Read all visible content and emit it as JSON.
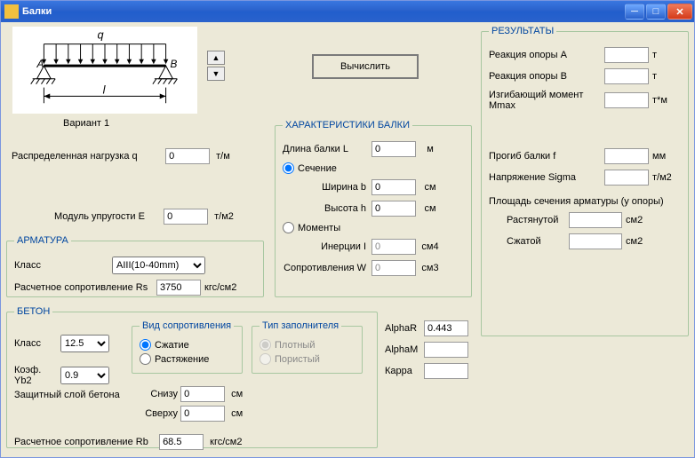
{
  "window": {
    "title": "Балки"
  },
  "diagram": {
    "q": "q",
    "A": "A",
    "B": "B",
    "l": "l",
    "variant": "Вариант 1"
  },
  "compute_button": "Вычислить",
  "inputs": {
    "dist_load_label": "Распределенная нагрузка  q",
    "dist_load_val": "0",
    "dist_load_unit": "т/м",
    "modE_label": "Модуль упругости  E",
    "modE_val": "0",
    "modE_unit": "т/м2"
  },
  "rebar": {
    "legend": "АРМАТУРА",
    "class_label": "Класс",
    "class_value": "AIII(10-40mm)",
    "Rs_label": "Расчетное сопротивление Rs",
    "Rs_val": "3750",
    "Rs_unit": "кгс/см2"
  },
  "concrete": {
    "legend": "БЕТОН",
    "class_label": "Класс",
    "class_value": "12.5",
    "yb2_label": "Коэф. Yb2",
    "yb2_value": "0.9",
    "resist_type_legend": "Вид сопротивления",
    "resist_compress": "Сжатие",
    "resist_tension": "Растяжение",
    "filler_legend": "Тип заполнителя",
    "filler_dense": "Плотный",
    "filler_porous": "Пористый",
    "cover_label": "Защитный слой бетона",
    "cover_bottom_label": "Снизу",
    "cover_bottom_val": "0",
    "cover_top_label": "Сверху",
    "cover_top_val": "0",
    "cover_unit": "см",
    "Rb_label": "Расчетное сопротивление Rb",
    "Rb_val": "68.5",
    "Rb_unit": "кгс/см2",
    "alphaR_label": "AlphaR",
    "alphaR_val": "0.443",
    "alphaM_label": "AlphaM",
    "alphaM_val": "",
    "kappa_label": "Карра",
    "kappa_val": ""
  },
  "beam": {
    "legend": "ХАРАКТЕРИСТИКИ БАЛКИ",
    "L_label": "Длина балки  L",
    "L_val": "0",
    "L_unit": "м",
    "section_label": "Сечение",
    "b_label": "Ширина  b",
    "b_val": "0",
    "h_label": "Высота  h",
    "h_val": "0",
    "cm": "см",
    "moments_label": "Моменты",
    "I_label": "Инерции  I",
    "I_val": "0",
    "I_unit": "см4",
    "W_label": "Сопротивления  W",
    "W_val": "0",
    "W_unit": "см3"
  },
  "results": {
    "legend": "РЕЗУЛЬТАТЫ",
    "RA_label": "Реакция опоры A",
    "RA_unit": "т",
    "RB_label": "Реакция опоры B",
    "RB_unit": "т",
    "Mmax_label": "Изгибающий момент Mmax",
    "Mmax_unit": "т*м",
    "f_label": "Прогиб балки  f",
    "f_unit": "мм",
    "sigma_label": "Напряжение Sigma",
    "sigma_unit": "т/м2",
    "As_caption": "Площадь сечения арматуры (у опоры)",
    "As_tension_label": "Растянутой",
    "As_compress_label": "Сжатой",
    "As_unit": "см2"
  }
}
